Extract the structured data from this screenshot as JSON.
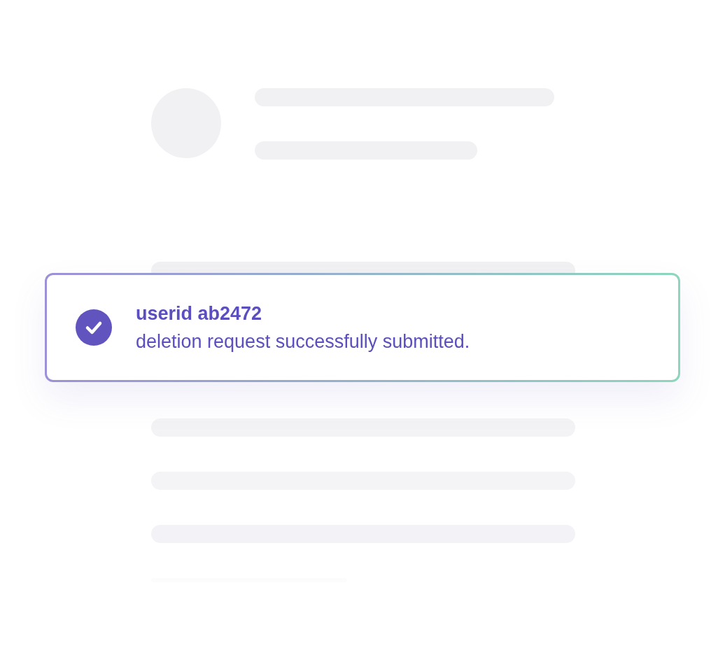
{
  "toast": {
    "title": "userid ab2472",
    "message": "deletion request successfully submitted."
  }
}
